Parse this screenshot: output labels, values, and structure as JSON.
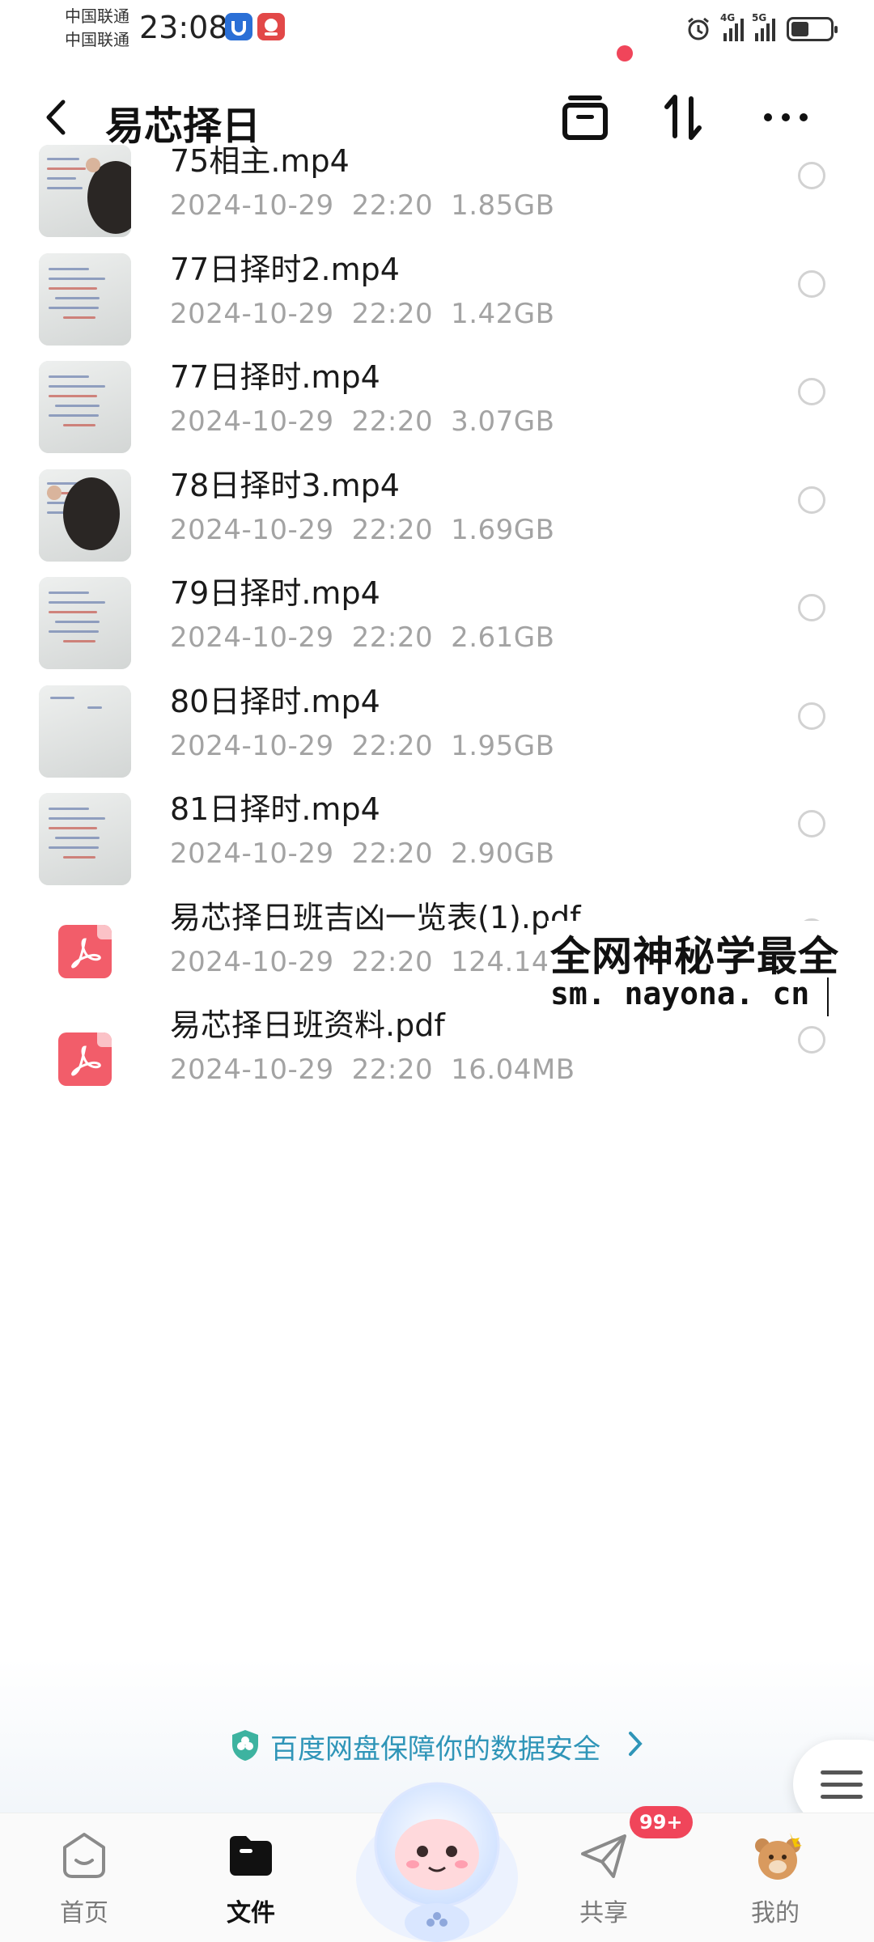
{
  "status_bar": {
    "carrier_1": "中国联通",
    "carrier_2": "中国联通",
    "time": "23:08",
    "signal_1": "4G",
    "signal_2": "5G",
    "battery_level": 0.45
  },
  "header": {
    "title": "易芯择日",
    "notification_dot_color": "#f0455a"
  },
  "files": [
    {
      "name": "75相主.mp4",
      "date": "2024-10-29",
      "time": "22:20",
      "size": "1.85GB",
      "type": "video",
      "thumb": "teacher-board"
    },
    {
      "name": "77日择时2.mp4",
      "date": "2024-10-29",
      "time": "22:20",
      "size": "1.42GB",
      "type": "video",
      "thumb": "board"
    },
    {
      "name": "77日择时.mp4",
      "date": "2024-10-29",
      "time": "22:20",
      "size": "3.07GB",
      "type": "video",
      "thumb": "board"
    },
    {
      "name": "78日择时3.mp4",
      "date": "2024-10-29",
      "time": "22:20",
      "size": "1.69GB",
      "type": "video",
      "thumb": "teacher-board"
    },
    {
      "name": "79日择时.mp4",
      "date": "2024-10-29",
      "time": "22:20",
      "size": "2.61GB",
      "type": "video",
      "thumb": "board"
    },
    {
      "name": "80日择时.mp4",
      "date": "2024-10-29",
      "time": "22:20",
      "size": "1.95GB",
      "type": "video",
      "thumb": "blank-board"
    },
    {
      "name": "81日择时.mp4",
      "date": "2024-10-29",
      "time": "22:20",
      "size": "2.90GB",
      "type": "video",
      "thumb": "board"
    },
    {
      "name": "易芯择日班吉凶一览表(1).pdf",
      "date": "2024-10-29",
      "time": "22:20",
      "size": "124.14KB",
      "type": "pdf"
    },
    {
      "name": "易芯择日班资料.pdf",
      "date": "2024-10-29",
      "time": "22:20",
      "size": "16.04MB",
      "type": "pdf"
    }
  ],
  "watermark": {
    "line1": "全网神秘学最全",
    "line2": "sm. nayona. cn"
  },
  "safety_banner": {
    "text": "百度网盘保障你的数据安全"
  },
  "bottom_nav": {
    "items": [
      {
        "label": "首页",
        "icon": "home-icon",
        "active": false
      },
      {
        "label": "文件",
        "icon": "folder-icon",
        "active": true
      },
      {
        "label": "共享",
        "icon": "share-plane-icon",
        "active": false
      },
      {
        "label": "我的",
        "icon": "profile-bear-icon",
        "active": false
      }
    ],
    "share_badge": "99+"
  },
  "colors": {
    "accent_red": "#f0455a",
    "pdf_red": "#f25d6a",
    "meta_gray": "#a3a3a3",
    "banner_teal": "#2f95b8"
  }
}
